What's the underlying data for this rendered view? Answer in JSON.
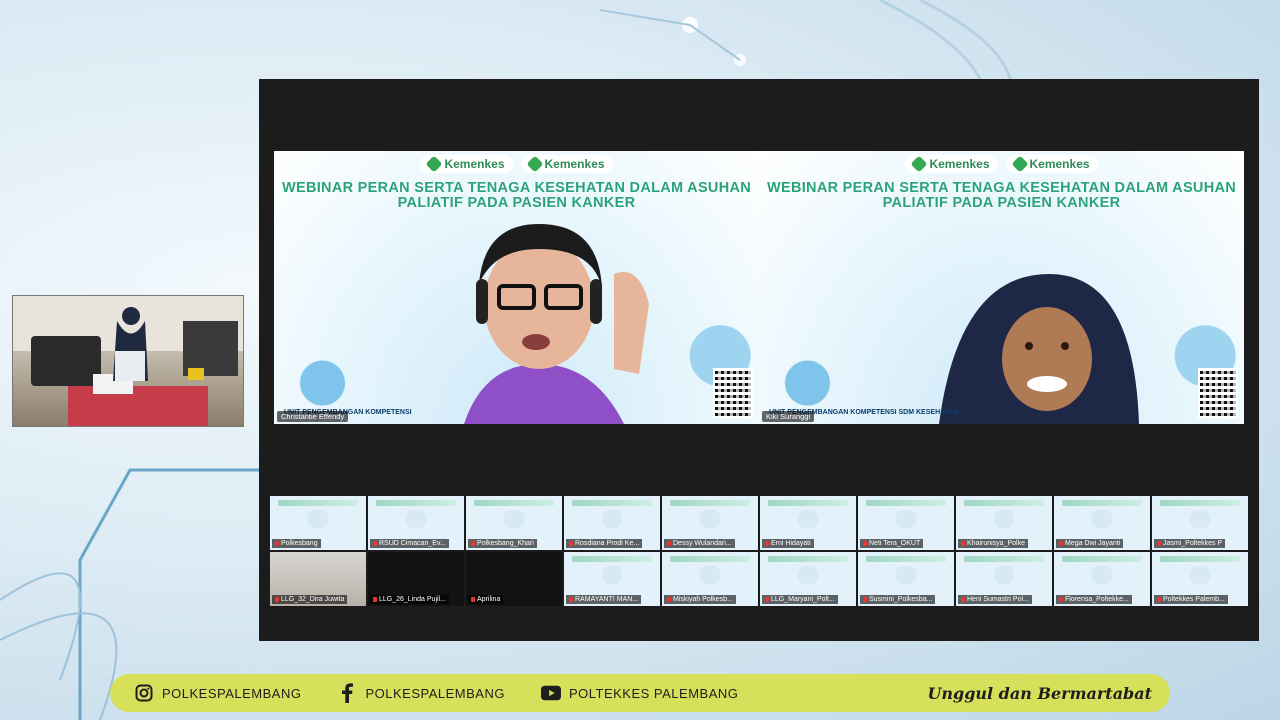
{
  "slide": {
    "logo_primary": "Kemenkes",
    "logo_secondary": "Kemenkes",
    "title_line1": "WEBINAR PERAN SERTA TENAGA KESEHATAN DALAM ASUHAN",
    "title_line2": "PALIATIF PADA PASIEN KANKER",
    "footer_left": "UNIT PENGEMBANGAN KOMPETENSI",
    "footer_right": "UNIT PENGEMBANGAN KOMPETENSI SDM KESEHATAN"
  },
  "speakers": [
    {
      "name": "Christantie Effendy",
      "active": true
    },
    {
      "name": "Kiki Suranggi",
      "active": false
    }
  ],
  "gallery": [
    {
      "name": "Polkesbang",
      "style": "slide"
    },
    {
      "name": "RSUD Cimacan_Ev...",
      "style": "slide"
    },
    {
      "name": "Polkesbang_Khari",
      "style": "slide"
    },
    {
      "name": "Rosdiana Prodi Ke...",
      "style": "slide"
    },
    {
      "name": "Dessy Wulandari...",
      "style": "slide"
    },
    {
      "name": "Erni Hidayati",
      "style": "slide"
    },
    {
      "name": "Neti Tera_OKUT",
      "style": "slide"
    },
    {
      "name": "Khairunisya_Polke",
      "style": "slide"
    },
    {
      "name": "Mega Dwi Jayanti",
      "style": "slide"
    },
    {
      "name": "Jasmi_Poltekkes P",
      "style": "slide"
    },
    {
      "name": "LLG_32_Dira Juwita",
      "style": "room"
    },
    {
      "name": "LLG_26_Linda Pujil...",
      "style": "dark"
    },
    {
      "name": "Aprilina",
      "style": "dark"
    },
    {
      "name": "RAMAYANTI MAN...",
      "style": "slide"
    },
    {
      "name": "Miskiyah Polkesb...",
      "style": "slide"
    },
    {
      "name": "LLG_Maryani_Polt...",
      "style": "slide"
    },
    {
      "name": "Susmini_Polkesba...",
      "style": "slide"
    },
    {
      "name": "Heni Sumastri Pol...",
      "style": "slide"
    },
    {
      "name": "Florensa_Poltekke...",
      "style": "slide"
    },
    {
      "name": "Poltekkes Palemb...",
      "style": "slide"
    }
  ],
  "footer": {
    "instagram": "POLKESPALEMBANG",
    "facebook": "POLKESPALEMBANG",
    "youtube": "POLTEKKES PALEMBANG",
    "tagline": "Unggul dan Bermartabat"
  },
  "colors": {
    "footer_bar": "#d7e05a",
    "title_green": "#2aa37a",
    "active_border": "#4cd964"
  }
}
